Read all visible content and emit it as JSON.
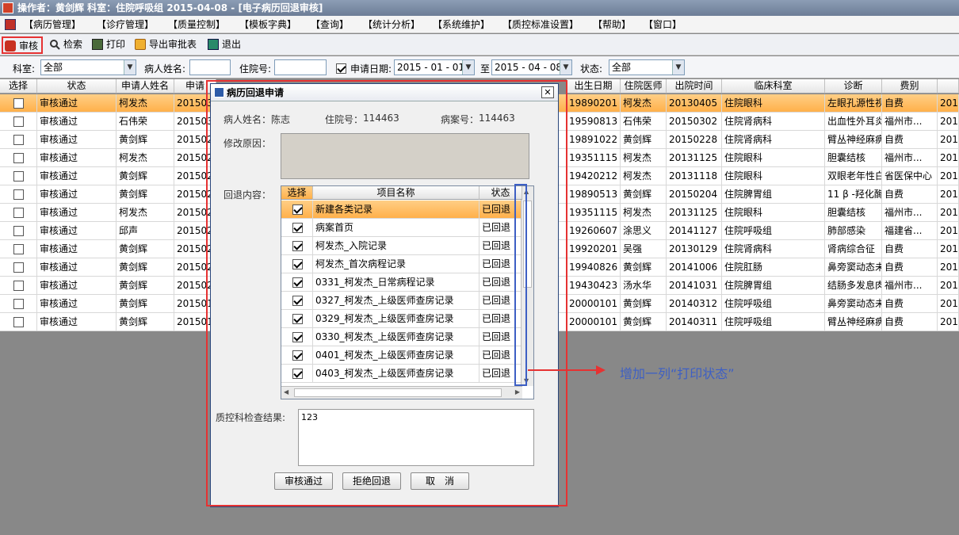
{
  "window": {
    "title": "操作者：黄剑辉   科室：住院呼吸组   2015-04-08 - [电子病历回退审核]"
  },
  "menu": [
    "【病历管理】",
    "【诊疗管理】",
    "【质量控制】",
    "【模板字典】",
    "【查询】",
    "【统计分析】",
    "【系统维护】",
    "【质控标准设置】",
    "【帮助】",
    "【窗口】"
  ],
  "toolbar": {
    "audit": "审核",
    "search": "检索",
    "print": "打印",
    "export": "导出审批表",
    "exit": "退出"
  },
  "filters": {
    "dept_label": "科室:",
    "dept_value": "全部",
    "name_label": "病人姓名:",
    "name_value": "",
    "inpatient_label": "住院号:",
    "inpatient_value": "",
    "date_label": "申请日期:",
    "date_from": "2015 - 01 - 01",
    "to_label": "至",
    "date_to": "2015 - 04 - 08",
    "status_label": "状态:",
    "status_value": "全部"
  },
  "grid": {
    "headers": [
      "选择",
      "状态",
      "申请人姓名",
      "申请",
      "出生日期",
      "住院医师",
      "出院时间",
      "临床科室",
      "诊断",
      "费别",
      ""
    ],
    "rows": [
      {
        "status": "审核通过",
        "applicant": "柯发杰",
        "apply": "201503",
        "birth": "19890201",
        "doctor": "柯发杰",
        "discharge": "20130405",
        "dept": "住院眼科",
        "diag": "左眼孔源性视...",
        "fee": "自费",
        "extra": "2013"
      },
      {
        "status": "审核通过",
        "applicant": "石伟荣",
        "apply": "201503",
        "birth": "19590813",
        "doctor": "石伟荣",
        "discharge": "20150302",
        "dept": "住院肾病科",
        "diag": "出血性外耳炎",
        "fee": "福州市...",
        "extra": "2013"
      },
      {
        "status": "审核通过",
        "applicant": "黄剑辉",
        "apply": "201502",
        "birth": "19891022",
        "doctor": "黄剑辉",
        "discharge": "20150228",
        "dept": "住院肾病科",
        "diag": "臂丛神经麻痹",
        "fee": "自费",
        "extra": "2014"
      },
      {
        "status": "审核通过",
        "applicant": "柯发杰",
        "apply": "201502",
        "birth": "19351115",
        "doctor": "柯发杰",
        "discharge": "20131125",
        "dept": "住院眼科",
        "diag": "胆囊结核",
        "fee": "福州市...",
        "extra": "2013"
      },
      {
        "status": "审核通过",
        "applicant": "黄剑辉",
        "apply": "201502",
        "birth": "19420212",
        "doctor": "柯发杰",
        "discharge": "20131118",
        "dept": "住院眼科",
        "diag": "双眼老年性白...",
        "fee": "省医保中心",
        "extra": "2013"
      },
      {
        "status": "审核通过",
        "applicant": "黄剑辉",
        "apply": "201502",
        "birth": "19890513",
        "doctor": "黄剑辉",
        "discharge": "20150204",
        "dept": "住院脾胃组",
        "diag": "11 β -羟化酶...",
        "fee": "自费",
        "extra": "2014"
      },
      {
        "status": "审核通过",
        "applicant": "柯发杰",
        "apply": "201502",
        "birth": "19351115",
        "doctor": "柯发杰",
        "discharge": "20131125",
        "dept": "住院眼科",
        "diag": "胆囊结核",
        "fee": "福州市...",
        "extra": "2013"
      },
      {
        "status": "审核通过",
        "applicant": "邱声",
        "apply": "201502",
        "birth": "19260607",
        "doctor": "涂思义",
        "discharge": "20141127",
        "dept": "住院呼吸组",
        "diag": "肺部感染",
        "fee": "福建省...",
        "extra": "2013"
      },
      {
        "status": "审核通过",
        "applicant": "黄剑辉",
        "apply": "201502",
        "birth": "19920201",
        "doctor": "吴强",
        "discharge": "20130129",
        "dept": "住院肾病科",
        "diag": "肾病综合征",
        "fee": "自费",
        "extra": "2012"
      },
      {
        "status": "审核通过",
        "applicant": "黄剑辉",
        "apply": "201502",
        "birth": "19940826",
        "doctor": "黄剑辉",
        "discharge": "20141006",
        "dept": "住院肛肠",
        "diag": "鼻旁窦动态未...",
        "fee": "自费",
        "extra": "2014"
      },
      {
        "status": "审核通过",
        "applicant": "黄剑辉",
        "apply": "201502",
        "birth": "19430423",
        "doctor": "汤水华",
        "discharge": "20141031",
        "dept": "住院脾胃组",
        "diag": "结肠多发息肉...",
        "fee": "福州市...",
        "extra": "2013"
      },
      {
        "status": "审核通过",
        "applicant": "黄剑辉",
        "apply": "201501",
        "birth": "20000101",
        "doctor": "黄剑辉",
        "discharge": "20140312",
        "dept": "住院呼吸组",
        "diag": "鼻旁窦动态未...",
        "fee": "自费",
        "extra": "2014"
      },
      {
        "status": "审核通过",
        "applicant": "黄剑辉",
        "apply": "201501",
        "birth": "20000101",
        "doctor": "黄剑辉",
        "discharge": "20140311",
        "dept": "住院呼吸组",
        "diag": "臂丛神经麻痹",
        "fee": "自费",
        "extra": "2014"
      }
    ]
  },
  "dialog": {
    "title": "病历回退申请",
    "patient_label": "病人姓名：",
    "patient_value": "陈志",
    "inpatient_label": "住院号：",
    "inpatient_value": "114463",
    "case_label": "病案号：",
    "case_value": "114463",
    "reason_label": "修改原因：",
    "content_label": "回退内容：",
    "sub_headers": [
      "选择",
      "项目名称",
      "状态"
    ],
    "items": [
      {
        "name": "新建各类记录",
        "status": "已回退"
      },
      {
        "name": "病案首页",
        "status": "已回退"
      },
      {
        "name": "柯发杰_入院记录",
        "status": "已回退"
      },
      {
        "name": "柯发杰_首次病程记录",
        "status": "已回退"
      },
      {
        "name": "0331_柯发杰_日常病程记录",
        "status": "已回退"
      },
      {
        "name": "0327_柯发杰_上级医师查房记录",
        "status": "已回退"
      },
      {
        "name": "0329_柯发杰_上级医师查房记录",
        "status": "已回退"
      },
      {
        "name": "0330_柯发杰_上级医师查房记录",
        "status": "已回退"
      },
      {
        "name": "0401_柯发杰_上级医师查房记录",
        "status": "已回退"
      },
      {
        "name": "0403_柯发杰_上级医师查房记录",
        "status": "已回退"
      }
    ],
    "qc_label": "质控科检查结果:",
    "qc_value": "123",
    "btn_pass": "审核通过",
    "btn_reject": "拒绝回退",
    "btn_cancel": "取　消"
  },
  "annotation": "增加一列“打印状态”"
}
